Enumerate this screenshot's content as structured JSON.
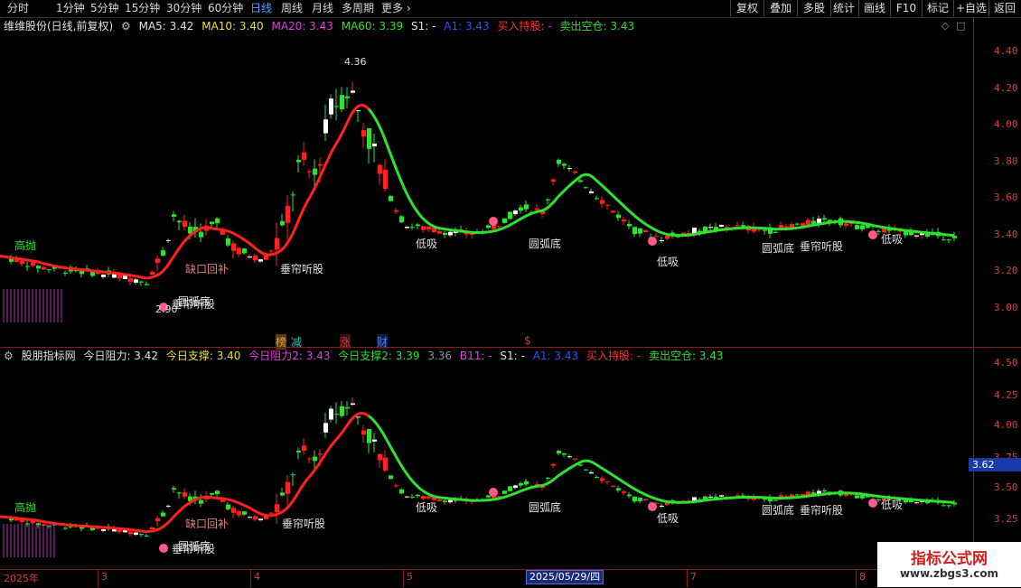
{
  "toolbar": {
    "periods": [
      "分时",
      "1分钟",
      "5分钟",
      "15分钟",
      "30分钟",
      "60分钟",
      "日线",
      "周线",
      "月线",
      "多周期",
      "更多"
    ],
    "active_period": "日线",
    "right": [
      "复权",
      "叠加",
      "多股",
      "统计",
      "画线",
      "F10",
      "标记",
      "+自选",
      "返回"
    ]
  },
  "upper": {
    "title": "维维股份(日线,前复权)",
    "legend": [
      {
        "text": "MA5: 3.42",
        "color": "#e0e0e0"
      },
      {
        "text": "MA10: 3.40",
        "color": "#e8e030"
      },
      {
        "text": "MA20: 3.43",
        "color": "#e040e0"
      },
      {
        "text": "MA60: 3.39",
        "color": "#30e030"
      },
      {
        "text": "S1: -",
        "color": "#e0e0e0"
      },
      {
        "text": "A1: 3.43",
        "color": "#3050ff"
      },
      {
        "text": "买入持股: -",
        "color": "#ff3030"
      },
      {
        "text": "卖出空仓: 3.43",
        "color": "#30e030"
      }
    ],
    "axis_ticks": [
      "4.40",
      "4.20",
      "4.00",
      "3.80",
      "3.60",
      "3.40",
      "3.20",
      "3.00"
    ],
    "labels": {
      "high": "4.36",
      "low": "2.90",
      "gaofang": "高抛",
      "quekou": "缺口回补",
      "chuilian1": "垂帘听股",
      "chuilian2": "垂帘听股",
      "dixi1": "低吸",
      "dixi2": "低吸",
      "dixi3": "低吸",
      "yuanhu1": "圆弧底",
      "yuanhu2": "圆弧底",
      "yuanhu3": "圆弧底",
      "r": "R",
      "w": "W"
    },
    "events": [
      {
        "text": "榜",
        "color": "#e0a030"
      },
      {
        "text": "减",
        "color": "#30c0c0"
      },
      {
        "text": "涨",
        "color": "#e03030"
      },
      {
        "text": "财",
        "color": "#4080ff"
      },
      {
        "text": "$",
        "color": "#e03030"
      }
    ]
  },
  "lower": {
    "title": "股朋指标网",
    "legend": [
      {
        "text": "今日阻力: 3.42",
        "color": "#e0e0e0"
      },
      {
        "text": "今日支撑: 3.40",
        "color": "#e8e030"
      },
      {
        "text": "今日阻力2: 3.43",
        "color": "#e040e0"
      },
      {
        "text": "今日支撑2: 3.39",
        "color": "#30e030"
      },
      {
        "text": "3.36",
        "color": "#909090"
      },
      {
        "text": "B11: -",
        "color": "#e040e0"
      },
      {
        "text": "S1: -",
        "color": "#e0e0e0"
      },
      {
        "text": "A1: 3.43",
        "color": "#3050ff"
      },
      {
        "text": "买入持股: -",
        "color": "#ff3030"
      },
      {
        "text": "卖出空仓: 3.43",
        "color": "#30e030"
      }
    ],
    "axis_ticks": [
      "4.50",
      "4.25",
      "4.00",
      "3.75",
      "3.50",
      "3.25"
    ],
    "current_price": "3.62",
    "labels": {
      "gaofang": "高抛",
      "quekou": "缺口回补",
      "chuilian1": "垂帘听股",
      "chuilian2": "垂帘听股",
      "dixi1": "低吸",
      "dixi2": "低吸",
      "dixi3": "低吸",
      "yuanhu1": "圆弧底",
      "yuanhu2": "圆弧底",
      "yuanhu3": "圆弧底",
      "r": "R",
      "w": "W"
    }
  },
  "dates": [
    "2025年",
    "3",
    "4",
    "5",
    "2025/05/29/四",
    "7",
    "8"
  ],
  "watermark": {
    "title": "指标公式网",
    "url": "www.zbgs3.com"
  },
  "colors": {
    "up": "#ff2020",
    "down": "#30e030",
    "neutral": "#ffffff",
    "axis": "#8b1a1a",
    "ma_red": "#ff2020",
    "ma_green": "#30e030"
  }
}
